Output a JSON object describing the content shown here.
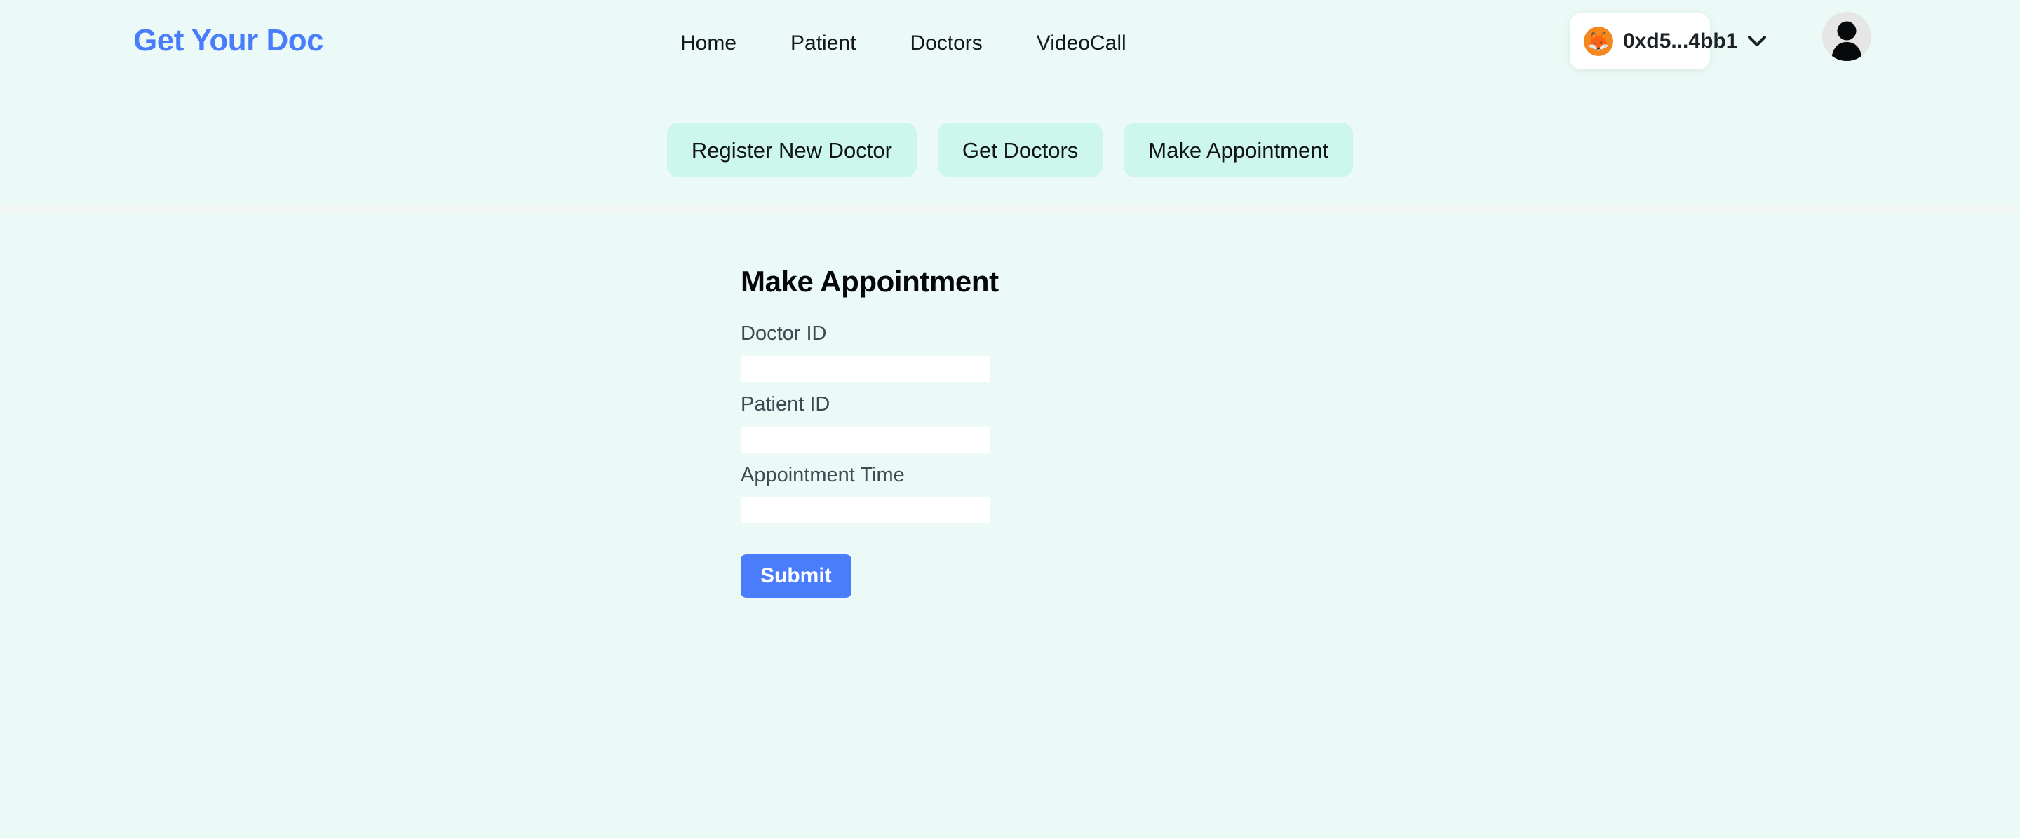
{
  "app": {
    "brand": "Get Your Doc",
    "background_color": "#ebfaf6",
    "accent_color": "#4a7dfc",
    "pill_color": "#ccf7ea"
  },
  "header": {
    "nav": [
      {
        "label": "Home"
      },
      {
        "label": "Patient"
      },
      {
        "label": "Doctors"
      },
      {
        "label": "VideoCall"
      }
    ],
    "wallet": {
      "icon": "metamask-fox-icon",
      "glyph": "🦊",
      "address": "0xd5...4bb1",
      "chevron": "chevron-down-icon",
      "badge_color": "#f4881f"
    },
    "avatar": {
      "icon": "user-avatar-icon"
    }
  },
  "tabs": [
    {
      "label": "Register New Doctor",
      "active": false
    },
    {
      "label": "Get Doctors",
      "active": false
    },
    {
      "label": "Make Appointment",
      "active": true
    }
  ],
  "form": {
    "title": "Make Appointment",
    "fields": [
      {
        "label": "Doctor ID",
        "value": "",
        "placeholder": ""
      },
      {
        "label": "Patient ID",
        "value": "",
        "placeholder": ""
      },
      {
        "label": "Appointment Time",
        "value": "",
        "placeholder": ""
      }
    ],
    "submit_label": "Submit"
  }
}
